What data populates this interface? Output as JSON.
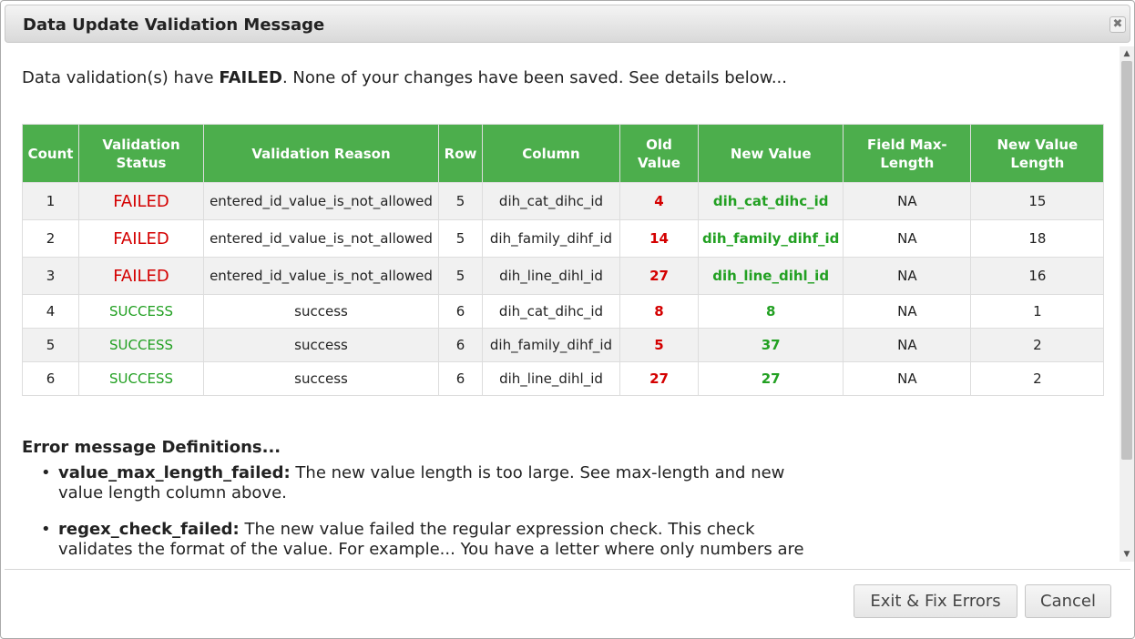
{
  "dialog": {
    "title": "Data Update Validation Message",
    "close_glyph": "✖"
  },
  "intro": {
    "prefix": "Data validation(s) have ",
    "status": "FAILED",
    "suffix": ". None of your changes have been saved. See details below..."
  },
  "table": {
    "headers": [
      "Count",
      "Validation Status",
      "Validation Reason",
      "Row",
      "Column",
      "Old Value",
      "New Value",
      "Field Max-Length",
      "New Value Length"
    ],
    "rows": [
      {
        "count": "1",
        "status": "FAILED",
        "reason": "entered_id_value_is_not_allowed",
        "row": "5",
        "column": "dih_cat_dihc_id",
        "old": "4",
        "new": "dih_cat_dihc_id",
        "max": "NA",
        "len": "15"
      },
      {
        "count": "2",
        "status": "FAILED",
        "reason": "entered_id_value_is_not_allowed",
        "row": "5",
        "column": "dih_family_dihf_id",
        "old": "14",
        "new": "dih_family_dihf_id",
        "max": "NA",
        "len": "18"
      },
      {
        "count": "3",
        "status": "FAILED",
        "reason": "entered_id_value_is_not_allowed",
        "row": "5",
        "column": "dih_line_dihl_id",
        "old": "27",
        "new": "dih_line_dihl_id",
        "max": "NA",
        "len": "16"
      },
      {
        "count": "4",
        "status": "SUCCESS",
        "reason": "success",
        "row": "6",
        "column": "dih_cat_dihc_id",
        "old": "8",
        "new": "8",
        "max": "NA",
        "len": "1"
      },
      {
        "count": "5",
        "status": "SUCCESS",
        "reason": "success",
        "row": "6",
        "column": "dih_family_dihf_id",
        "old": "5",
        "new": "37",
        "max": "NA",
        "len": "2"
      },
      {
        "count": "6",
        "status": "SUCCESS",
        "reason": "success",
        "row": "6",
        "column": "dih_line_dihl_id",
        "old": "27",
        "new": "27",
        "max": "NA",
        "len": "2"
      }
    ]
  },
  "definitions": {
    "heading": "Error message Definitions...",
    "items": [
      {
        "term": "value_max_length_failed:",
        "text": " The new value length is too large. See max-length and new value length column above."
      },
      {
        "term": "regex_check_failed:",
        "text": " The new value failed the regular expression check. This check validates the format of the value. For example... You have a letter where only numbers are allowed."
      }
    ]
  },
  "buttons": {
    "exit": "Exit & Fix Errors",
    "cancel": "Cancel"
  },
  "icons": {
    "close": "close-icon",
    "scroll_up": "scroll-up-arrow-icon",
    "scroll_down": "scroll-down-arrow-icon"
  },
  "colors": {
    "header_green": "#4cae4c",
    "failed_red": "#d40000",
    "success_green": "#22a022"
  }
}
